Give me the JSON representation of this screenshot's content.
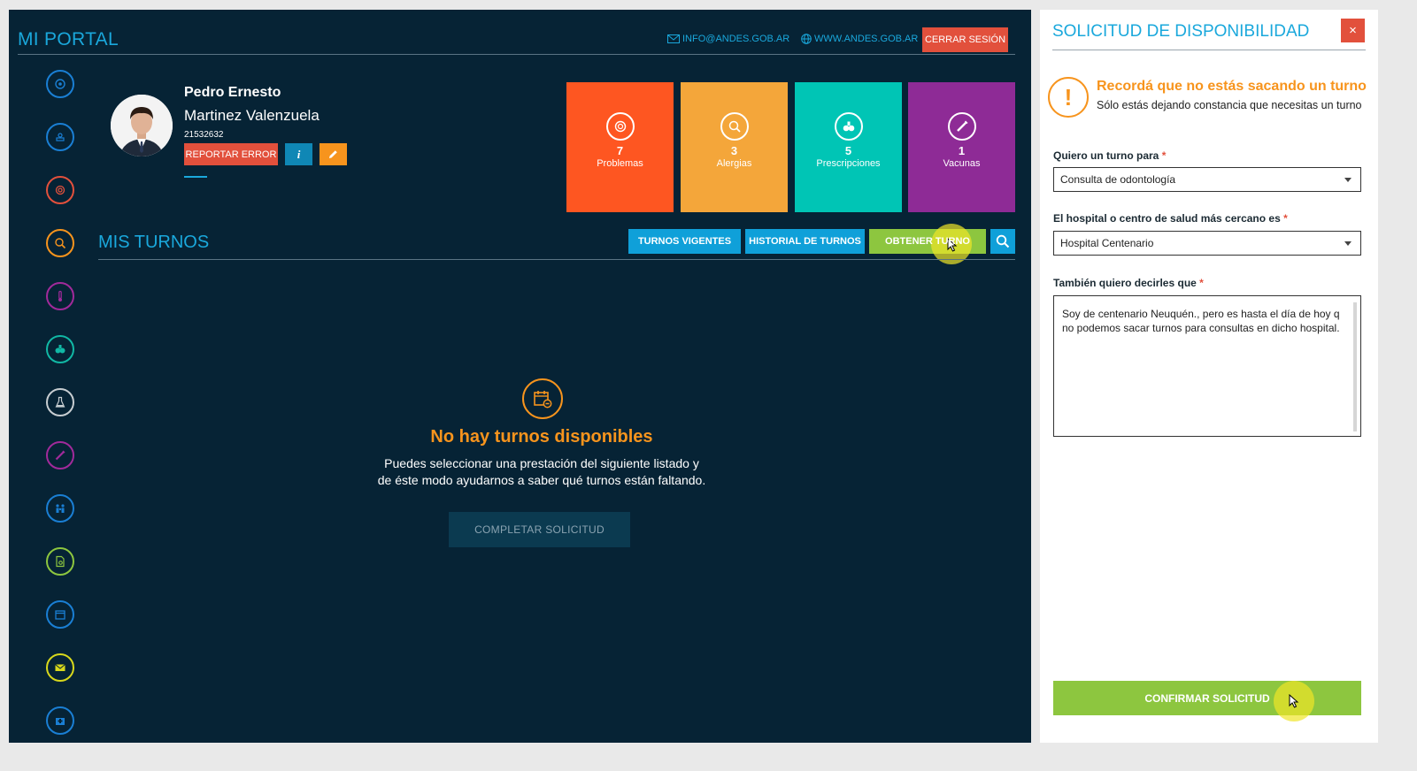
{
  "header": {
    "title": "MI PORTAL",
    "email_link": "INFO@ANDES.GOB.AR",
    "web_link": "WWW.ANDES.GOB.AR",
    "logout_label": "CERRAR SESIÓN"
  },
  "sidenav": [
    {
      "icon": "target-icon",
      "color": "#1a7fd4"
    },
    {
      "icon": "hand-icon",
      "color": "#1a7fd4"
    },
    {
      "icon": "problem-icon",
      "color": "#e2503c"
    },
    {
      "icon": "allergy-icon",
      "color": "#f7941d"
    },
    {
      "icon": "thermometer-icon",
      "color": "#a12a9b"
    },
    {
      "icon": "pills-icon",
      "color": "#11b8a5"
    },
    {
      "icon": "lab-flask-icon",
      "color": "#c7cdd1"
    },
    {
      "icon": "vaccine-icon",
      "color": "#a12a9b"
    },
    {
      "icon": "family-icon",
      "color": "#1a7fd4"
    },
    {
      "icon": "document-icon",
      "color": "#8dc63f"
    },
    {
      "icon": "calendar-icon",
      "color": "#1a7fd4"
    },
    {
      "icon": "mail-icon",
      "color": "#d8d81c"
    },
    {
      "icon": "hospital-icon",
      "color": "#1a7fd4"
    }
  ],
  "profile": {
    "first_name": "Pedro Ernesto",
    "last_name": "Martinez Valenzuela",
    "document": "21532632",
    "report_error_label": "REPORTAR ERROR",
    "info_label": "i"
  },
  "stats": [
    {
      "count": "7",
      "label": "Problemas",
      "color": "#fe5621",
      "icon": "problem-icon"
    },
    {
      "count": "3",
      "label": "Alergias",
      "color": "#f4a63a",
      "icon": "allergy-icon"
    },
    {
      "count": "5",
      "label": "Prescripciones",
      "color": "#00c5b5",
      "icon": "pills-icon"
    },
    {
      "count": "1",
      "label": "Vacunas",
      "color": "#8e2b96",
      "icon": "vaccine-icon"
    }
  ],
  "turnos": {
    "title": "MIS TURNOS",
    "tabs": [
      {
        "label": "TURNOS VIGENTES",
        "color": "#0fa0d9"
      },
      {
        "label": "HISTORIAL DE TURNOS",
        "color": "#0fa0d9"
      },
      {
        "label": "OBTENER TURNO",
        "color": "#8dc63f"
      }
    ],
    "empty_title": "No hay turnos disponibles",
    "empty_line1": "Puedes seleccionar una prestación del siguiente listado y",
    "empty_line2": "de éste modo ayudarnos a saber qué turnos están faltando.",
    "complete_label": "COMPLETAR SOLICITUD"
  },
  "drawer": {
    "title": "SOLICITUD DE DISPONIBILIDAD",
    "close_label": "×",
    "warning_title": "Recordá que no estás sacando un turno",
    "warning_sub": "Sólo estás dejando constancia que necesitas un turno",
    "field1_label": "Quiero un turno para",
    "field1_value": "Consulta de odontología",
    "field2_label": "El hospital o centro de salud más cercano es",
    "field2_value": "Hospital Centenario",
    "field3_label": "También quiero decirles que",
    "field3_value": "Soy de centenario Neuquén., pero es hasta el día de hoy q no podemos sacar turnos para consultas en dicho hospital.",
    "required_mark": "*",
    "confirm_label": "CONFIRMAR SOLICITUD"
  }
}
